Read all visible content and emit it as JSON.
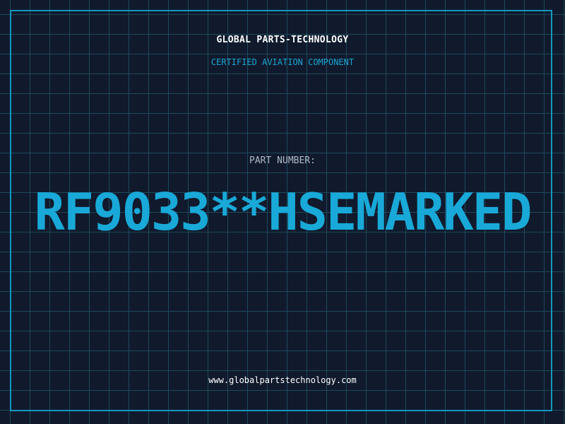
{
  "header": {
    "company": "GLOBAL PARTS-TECHNOLOGY",
    "subtitle": "CERTIFIED AVIATION COMPONENT"
  },
  "main": {
    "part_label": "PART NUMBER:",
    "part_number": "RF9033**HSEMARKED"
  },
  "footer": {
    "website": "www.globalpartstechnology.com"
  },
  "colors": {
    "background": "#101a2c",
    "grid": "#1c4a5c",
    "accent": "#19a9d8",
    "border": "#1497bf"
  }
}
